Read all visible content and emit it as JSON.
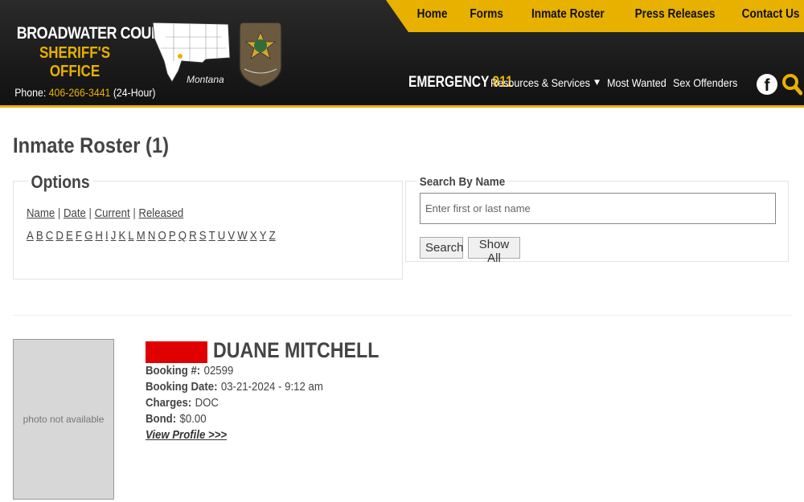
{
  "topnav": [
    "Home",
    "Forms",
    "Inmate Roster",
    "Press Releases",
    "Contact Us"
  ],
  "brand": {
    "line1": "BROADWATER COUNTY",
    "line2": "SHERIFF'S OFFICE",
    "phone_label": "Phone:",
    "phone": "406-266-3441",
    "phone_note": "(24-Hour)",
    "map_label": "Montana"
  },
  "mainnav": {
    "emergency_label": "EMERGENCY",
    "emergency_number": "911",
    "items": [
      "Resources & Services",
      "Most Wanted",
      "Sex Offenders"
    ]
  },
  "page": {
    "title": "Inmate Roster (1)"
  },
  "options": {
    "legend": "Options",
    "sort_links": [
      "Name",
      "Date",
      "Current",
      "Released"
    ],
    "letters": [
      "A",
      "B",
      "C",
      "D",
      "E",
      "F",
      "G",
      "H",
      "I",
      "J",
      "K",
      "L",
      "M",
      "N",
      "O",
      "P",
      "Q",
      "R",
      "S",
      "T",
      "U",
      "V",
      "W",
      "X",
      "Y",
      "Z"
    ]
  },
  "search": {
    "legend": "Search By Name",
    "placeholder": "Enter first or last name",
    "search_button": "Search",
    "show_all_button": "Show All"
  },
  "inmate": {
    "photo_text": "photo not available",
    "name": "DUANE MITCHELL",
    "booking_number_label": "Booking #:",
    "booking_number": "02599",
    "booking_date_label": "Booking Date:",
    "booking_date": "03-21-2024 - 9:12 am",
    "charges_label": "Charges:",
    "charges": "DOC",
    "bond_label": "Bond:",
    "bond": "$0.00",
    "profile_link": "View Profile >>>"
  },
  "colors": {
    "accent": "#e8b100",
    "header_bg": "#1a1a1a",
    "redaction": "#e00000"
  }
}
